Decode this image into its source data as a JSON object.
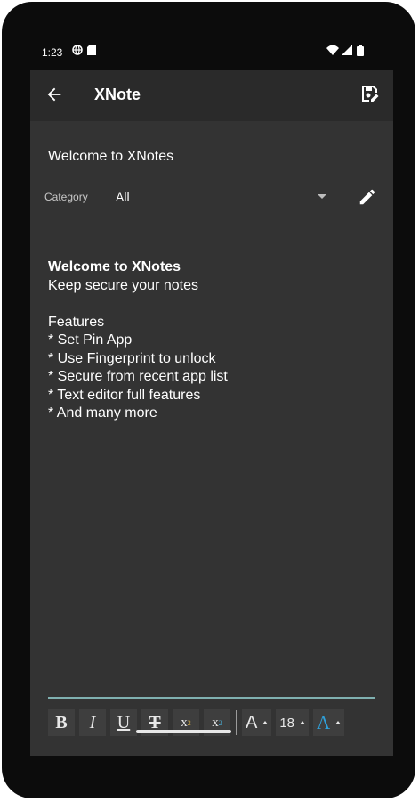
{
  "status": {
    "time": "1:23",
    "icons": [
      "globe-icon",
      "sd-card-icon",
      "wifi-icon",
      "signal-icon",
      "battery-icon"
    ]
  },
  "appbar": {
    "title": "XNote",
    "back_icon": "arrow-left-icon",
    "save_icon": "save-note-icon"
  },
  "note": {
    "title": "Welcome to XNotes",
    "category_label": "Category",
    "category_value": "All",
    "body": [
      {
        "text": "Welcome to XNotes",
        "bold": true
      },
      {
        "text": "Keep secure your notes",
        "bold": false
      },
      {
        "text": "",
        "bold": false
      },
      {
        "text": "Features",
        "bold": false
      },
      {
        "text": "* Set Pin App",
        "bold": false
      },
      {
        "text": "* Use Fingerprint to unlock",
        "bold": false
      },
      {
        "text": "* Secure from recent app list",
        "bold": false
      },
      {
        "text": "* Text editor full features",
        "bold": false
      },
      {
        "text": "* And many more",
        "bold": false
      }
    ]
  },
  "toolbar": {
    "bold": "B",
    "italic": "I",
    "underline": "U",
    "strike": "T",
    "superscript": "x",
    "superscript_mark": "2",
    "subscript": "x",
    "subscript_mark": "2",
    "font": "A",
    "size": "18",
    "color": "A"
  },
  "colors": {
    "background": "#333333",
    "appbar": "#2a2a2a",
    "accent": "#7fb0b0",
    "text_color_button": "#2f9fd8"
  }
}
